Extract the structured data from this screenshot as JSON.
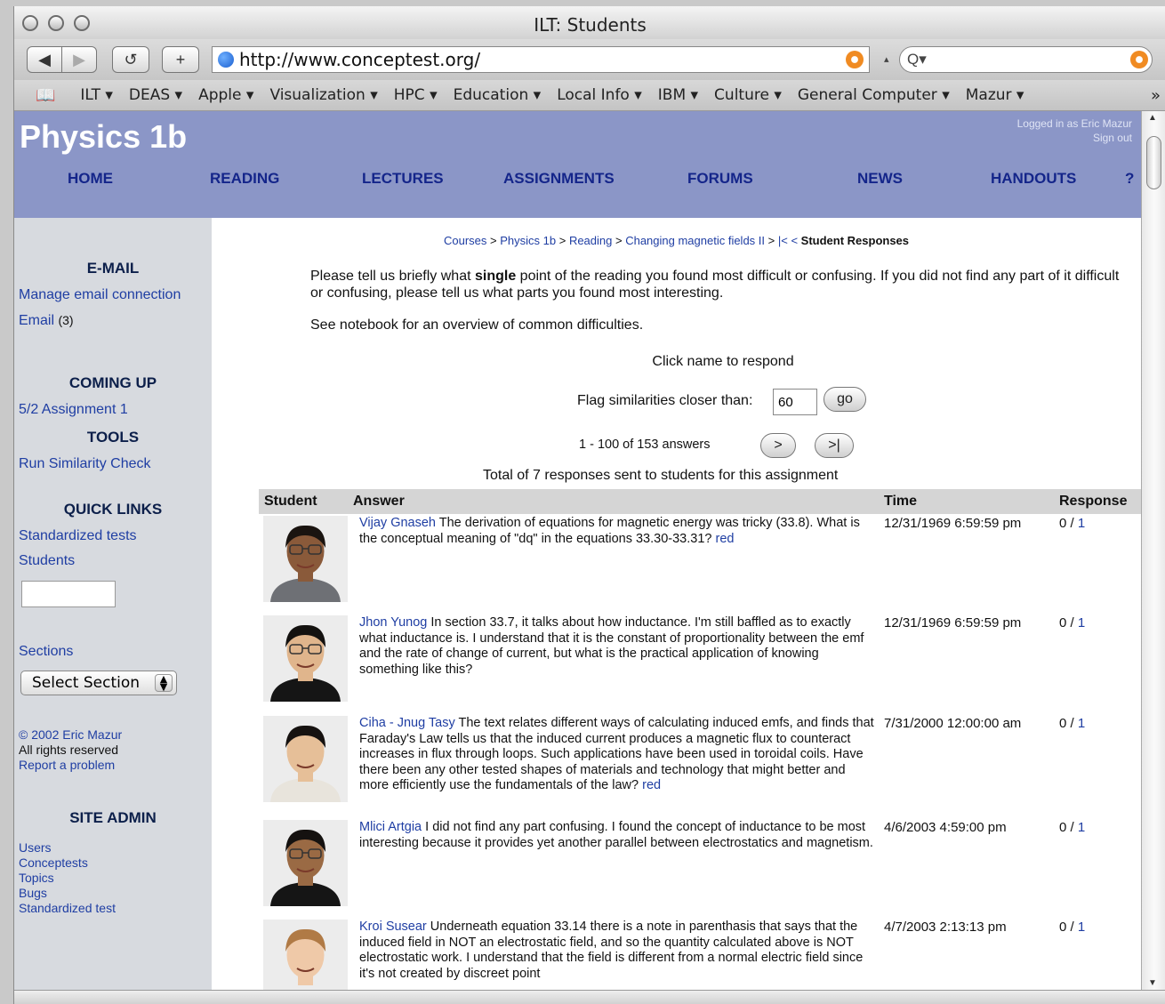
{
  "window": {
    "title": "ILT: Students"
  },
  "toolbar": {
    "url": "http://www.conceptest.org/",
    "back_glyph": "◀",
    "forward_glyph": "▶",
    "reload_glyph": "↺",
    "add_glyph": "+",
    "search_glyph": "Q▾",
    "more_glyph": "»"
  },
  "bookmarks": [
    "ILT ▾",
    "DEAS ▾",
    "Apple ▾",
    "Visualization ▾",
    "HPC ▾",
    "Education ▾",
    "Local Info ▾",
    "IBM ▾",
    "Culture ▾",
    "General Computer ▾",
    "Mazur ▾"
  ],
  "header": {
    "course_title": "Physics 1b",
    "logged_in": "Logged in as Eric Mazur",
    "sign_out": "Sign out",
    "nav": [
      "HOME",
      "READING",
      "LECTURES",
      "ASSIGNMENTS",
      "FORUMS",
      "NEWS",
      "HANDOUTS",
      "?"
    ]
  },
  "sidebar": {
    "email_heading": "E-MAIL",
    "manage_email": "Manage email connection",
    "email_link": "Email",
    "email_count": "(3)",
    "coming_up_heading": "COMING UP",
    "assignment": "5/2 Assignment 1",
    "tools_heading": "TOOLS",
    "similarity": "Run Similarity Check",
    "quick_links_heading": "QUICK LINKS",
    "standardized_tests": "Standardized tests",
    "students": "Students",
    "search_value": "",
    "sections": "Sections",
    "select_section": "Select Section",
    "copyright": "© 2002 Eric Mazur",
    "rights": "All rights reserved",
    "report": "Report a problem",
    "site_admin_heading": "SITE ADMIN",
    "admin_links": [
      "Users",
      "Conceptests",
      "Topics",
      "Bugs",
      "Standardized test"
    ]
  },
  "content": {
    "breadcrumb_links": [
      "Courses",
      "Physics 1b",
      "Reading",
      "Changing magnetic fields II",
      "|<",
      "<"
    ],
    "breadcrumb_current": "Student Responses",
    "question_pre": "Please tell us briefly what ",
    "question_bold": "single",
    "question_post": " point of the reading you found most difficult or confusing. If you did not find any part of it difficult or confusing, please tell us what parts you found most interesting.",
    "notebook_pre": "See ",
    "notebook_link": "notebook",
    "notebook_post": " for an overview of common difficulties.",
    "click_name": "Click name to respond",
    "flag_label": "Flag similarities closer than:",
    "flag_value": "60",
    "go": "go",
    "count": "1 - 100 of 153 answers",
    "next": ">",
    "last": ">|",
    "total": "Total of 7 responses sent to students for this assignment",
    "columns": [
      "Student",
      "Answer",
      "Time",
      "Response"
    ],
    "rows": [
      {
        "name": "Vijay Gnaseh",
        "answer": " The derivation of equations for magnetic energy was tricky (33.8). What is the conceptual meaning of \"dq\" in the equations 33.30-33.31? ",
        "red": "red",
        "time": "12/31/1969 6:59:59 pm",
        "resp_a": "0 / ",
        "resp_b": "1",
        "skin": "#8a5a3a",
        "hair": "#1a1410",
        "shirt": "#6e7075",
        "glasses": true
      },
      {
        "name": "Jhon Yunog",
        "answer": " In section 33.7, it talks about how inductance. I'm still baffled as to exactly what inductance is. I understand that it is the constant of proportionality between the emf and the rate of change of current, but what is the practical application of knowing something like this?",
        "red": "",
        "time": "12/31/1969 6:59:59 pm",
        "resp_a": "0 / ",
        "resp_b": "1",
        "skin": "#e0b58c",
        "hair": "#141210",
        "shirt": "#151515",
        "glasses": true
      },
      {
        "name": "Ciha - Jnug Tasy",
        "answer": " The text relates different ways of calculating induced emfs, and finds that Faraday's Law tells us that the induced current produces a magnetic flux to counteract increases in flux through loops. Such applications have been used in toroidal coils. Have there been any other tested shapes of materials and technology that might better and more efficiently use the fundamentals of the law? ",
        "red": "red",
        "time": "7/31/2000 12:00:00 am",
        "resp_a": "0 / ",
        "resp_b": "1",
        "skin": "#e6bf98",
        "hair": "#161210",
        "shirt": "#e8e4dc",
        "glasses": false
      },
      {
        "name": "Mlici Artgia",
        "answer": " I did not find any part confusing. I found the concept of inductance to be most interesting because it provides yet another parallel between electrostatics and magnetism.",
        "red": "",
        "time": "4/6/2003 4:59:00 pm",
        "resp_a": "0 / ",
        "resp_b": "1",
        "skin": "#9a6a44",
        "hair": "#151210",
        "shirt": "#151515",
        "glasses": true
      },
      {
        "name": "Kroi Susear",
        "answer": " Underneath equation 33.14 there is a note in parenthasis that says that the induced field in NOT an electrostatic field, and so the quantity calculated above is NOT electrostatic work. I understand that the field is different from a normal electric field since it's not created by discreet point",
        "red": "",
        "time": "4/7/2003 2:13:13 pm",
        "resp_a": "0 / ",
        "resp_b": "1",
        "skin": "#efc9a8",
        "hair": "#b07a45",
        "shirt": "#ececec",
        "glasses": false
      }
    ]
  }
}
